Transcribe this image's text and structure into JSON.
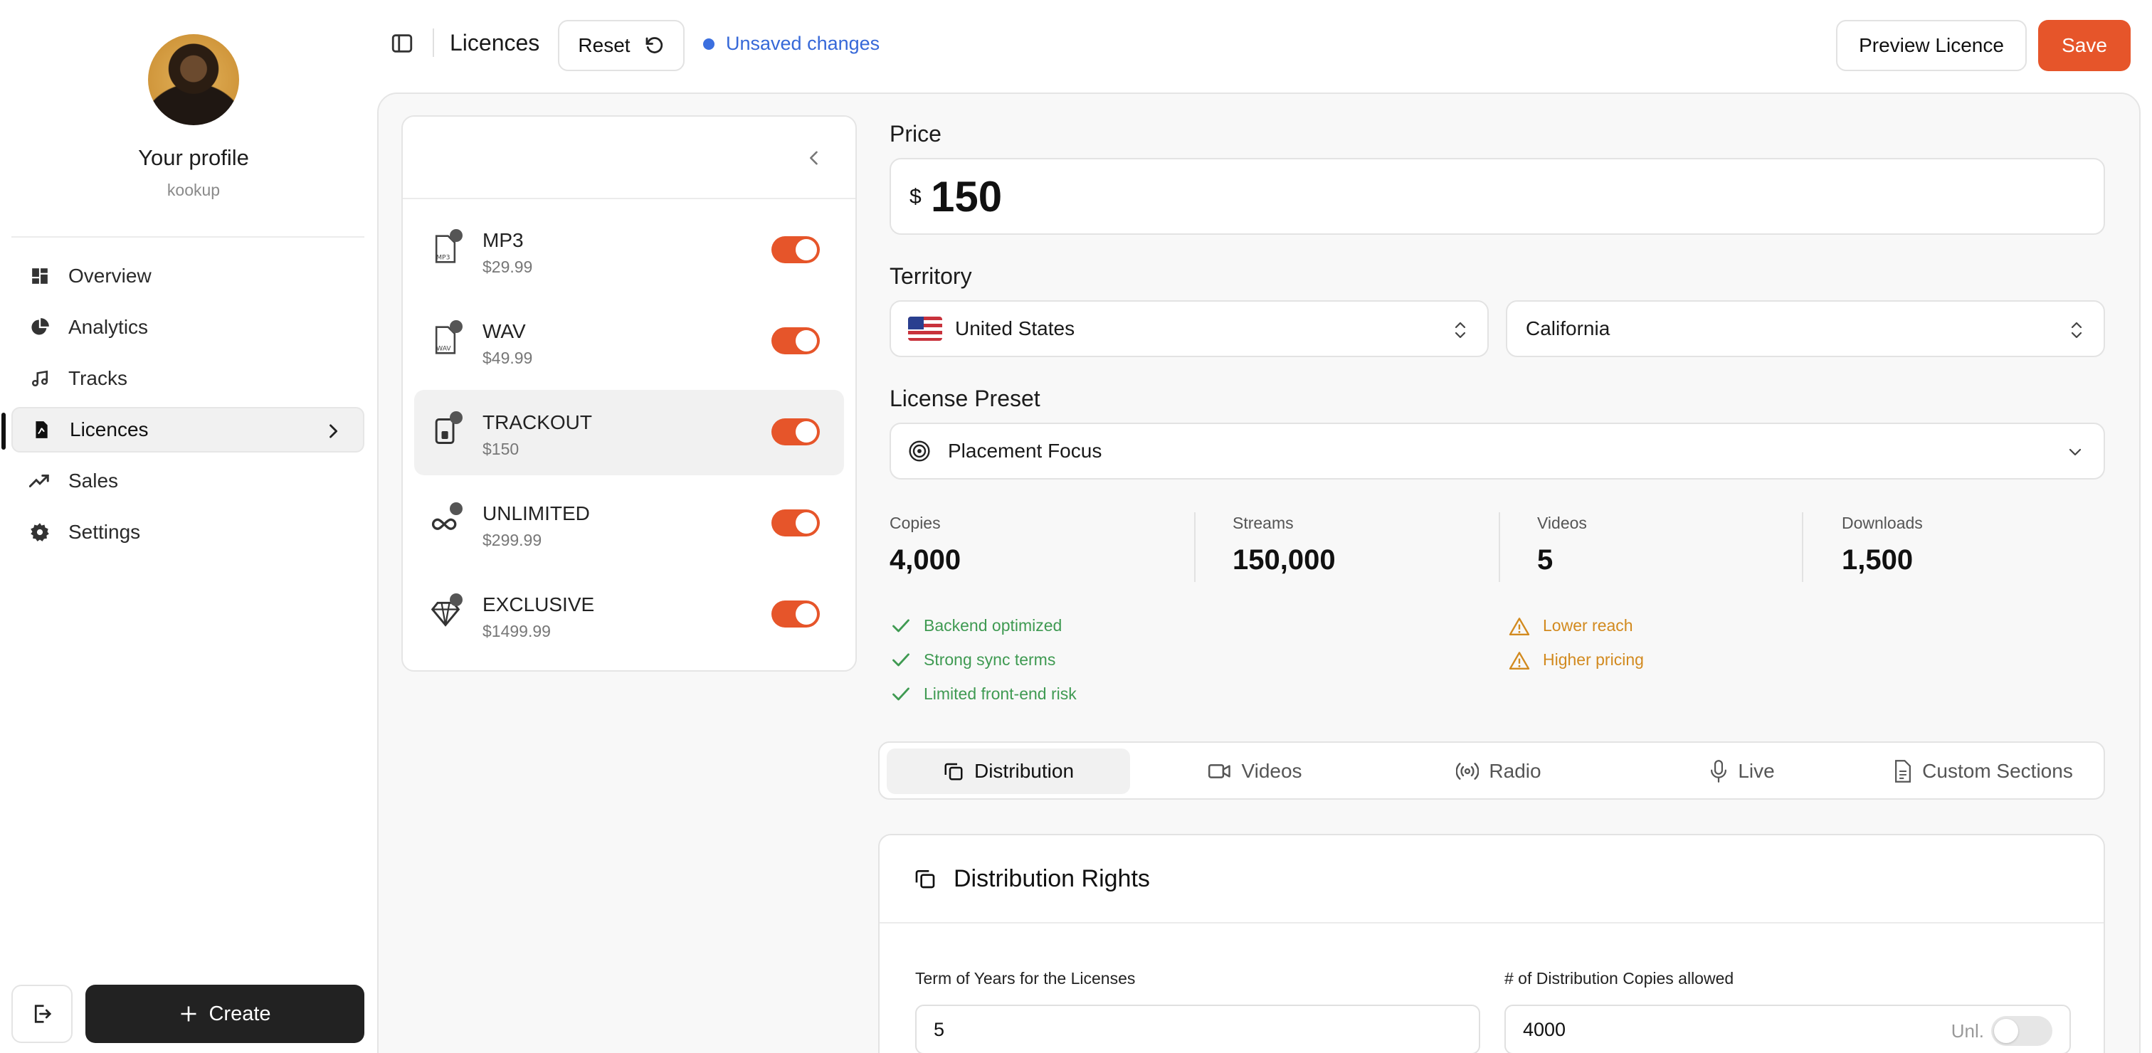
{
  "profile": {
    "name": "Your profile",
    "handle": "kookup"
  },
  "sidebar": {
    "items": [
      {
        "label": "Overview",
        "icon": "dashboard-icon"
      },
      {
        "label": "Analytics",
        "icon": "pie-chart-icon"
      },
      {
        "label": "Tracks",
        "icon": "music-note-icon"
      },
      {
        "label": "Licences",
        "icon": "license-file-icon",
        "active": true
      },
      {
        "label": "Sales",
        "icon": "trending-up-icon"
      },
      {
        "label": "Settings",
        "icon": "gear-icon"
      }
    ],
    "create_label": "Create"
  },
  "topbar": {
    "title": "Licences",
    "reset_label": "Reset",
    "unsaved_label": "Unsaved changes",
    "preview_label": "Preview Licence",
    "save_label": "Save"
  },
  "licences": [
    {
      "name": "MP3",
      "price": "$29.99",
      "enabled": true
    },
    {
      "name": "WAV",
      "price": "$49.99",
      "enabled": true
    },
    {
      "name": "TRACKOUT",
      "price": "$150",
      "enabled": true,
      "selected": true
    },
    {
      "name": "UNLIMITED",
      "price": "$299.99",
      "enabled": true
    },
    {
      "name": "EXCLUSIVE",
      "price": "$1499.99",
      "enabled": true
    }
  ],
  "editor": {
    "price_label": "Price",
    "currency": "$",
    "price": "150",
    "territory_label": "Territory",
    "country": "United States",
    "region": "California",
    "preset_label": "License Preset",
    "preset": "Placement Focus",
    "stats": [
      {
        "label": "Copies",
        "value": "4,000"
      },
      {
        "label": "Streams",
        "value": "150,000"
      },
      {
        "label": "Videos",
        "value": "5"
      },
      {
        "label": "Downloads",
        "value": "1,500"
      }
    ],
    "pros": [
      "Backend optimized",
      "Strong sync terms",
      "Limited front-end risk"
    ],
    "cons": [
      "Lower reach",
      "Higher pricing"
    ]
  },
  "tabs": [
    {
      "label": "Distribution",
      "active": true
    },
    {
      "label": "Videos"
    },
    {
      "label": "Radio"
    },
    {
      "label": "Live"
    },
    {
      "label": "Custom Sections"
    }
  ],
  "distribution": {
    "title": "Distribution Rights",
    "term_label": "Term of Years for the Licenses",
    "term_value": "5",
    "copies_label": "# of Distribution Copies allowed",
    "copies_value": "4000",
    "unlimited_label": "Unl."
  },
  "colors": {
    "accent": "#e6552a",
    "link": "#3668d8",
    "good": "#3f9a52",
    "warn": "#d28a1f"
  }
}
